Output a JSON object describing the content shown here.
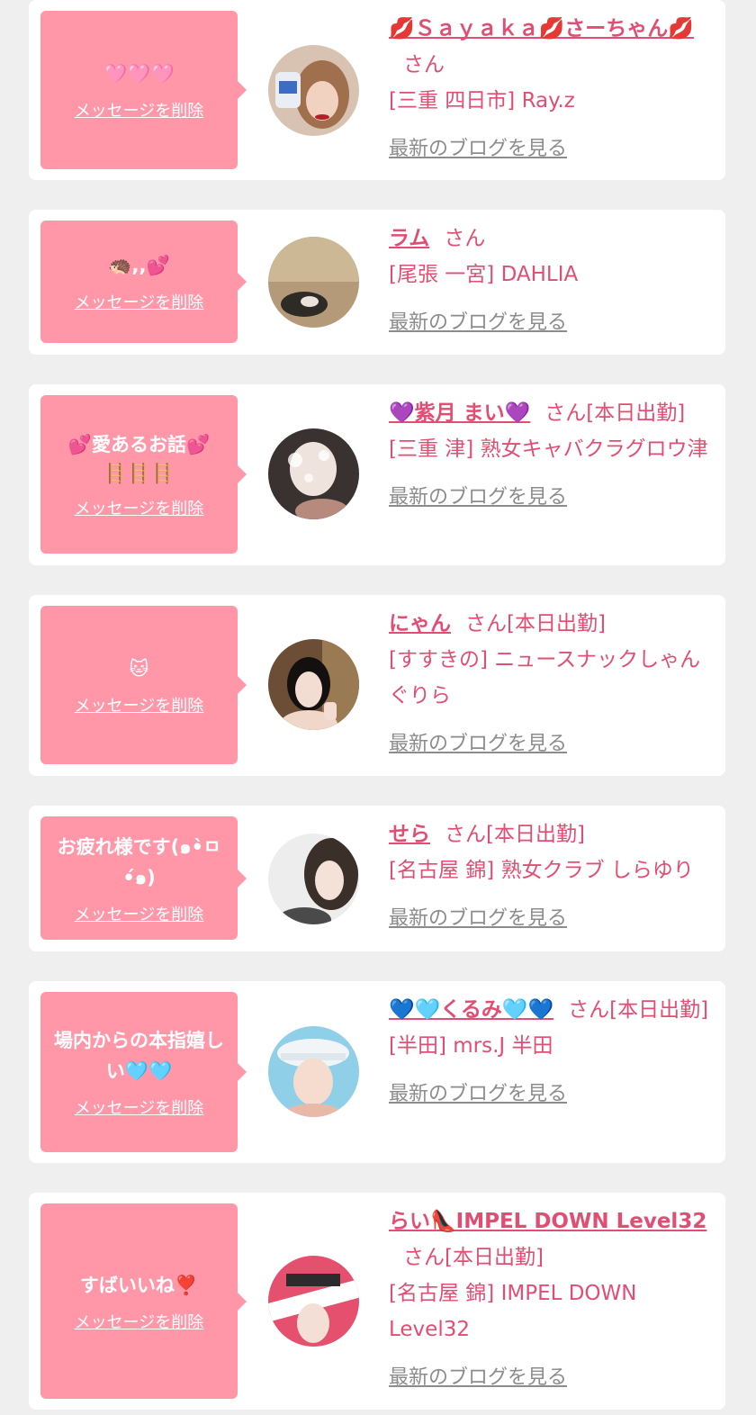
{
  "delete_label": "メッセージを削除",
  "blog_label": "最新のブログを見る",
  "san_label": "さん",
  "colors": {
    "background": "#efefef",
    "card": "#ffffff",
    "bubble": "#ff97a9",
    "name": "#e24e73",
    "link_gray": "#8c8c8c"
  },
  "cards": [
    {
      "message": "🩷🩷🩷",
      "name": "💋Ｓａｙａｋａ💋さーちゃん💋",
      "status": "",
      "shop": "[三重 四日市] Ray.z"
    },
    {
      "message": "🦔,,💕",
      "name": "ラム",
      "status": "",
      "shop": "[尾張 一宮] DAHLIA"
    },
    {
      "message": "💕愛あるお話💕",
      "message2": "🪜🪜🪜",
      "name": "💜紫月 まい💜",
      "status": "[本日出勤]",
      "shop": "[三重 津] 熟女キャバクラグロウ津"
    },
    {
      "message": "🐱",
      "name": "にゃん",
      "status": "[本日出勤]",
      "shop": "[すすきの] ニュースナックしゃんぐりら"
    },
    {
      "message": "お疲れ様です(๑•̀ㅁ•́๑)",
      "name": "せら",
      "status": "[本日出勤]",
      "shop": "[名古屋 錦] 熟女クラブ しらゆり"
    },
    {
      "message": "場内からの本指嬉しい🩵🩵",
      "name": "💙🩵くるみ🩵💙",
      "status": "[本日出勤]",
      "shop": "[半田] mrs.J 半田"
    },
    {
      "message": "すばいいね❣️",
      "name": "らい👠IMPEL DOWN Level32",
      "status": "[本日出勤]",
      "shop": "[名古屋 錦] IMPEL DOWN Level32"
    }
  ]
}
